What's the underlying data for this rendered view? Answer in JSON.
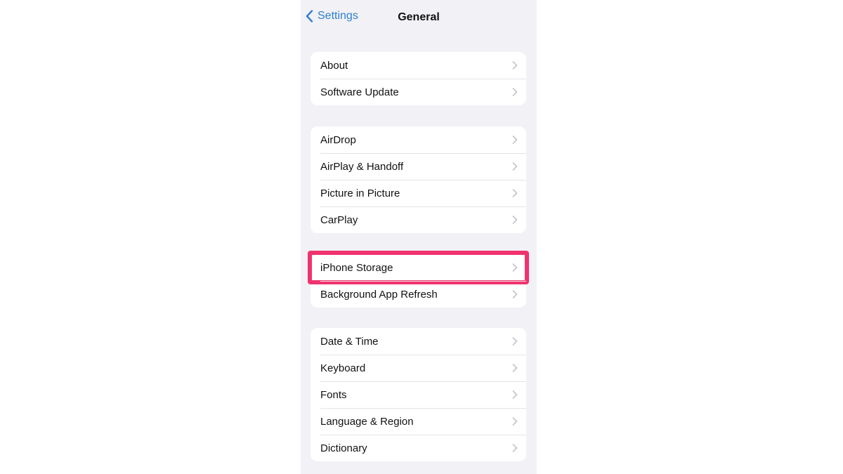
{
  "nav": {
    "back_label": "Settings",
    "title": "General"
  },
  "highlight_color": "#f0336e",
  "groups": [
    {
      "items": [
        {
          "label": "About"
        },
        {
          "label": "Software Update"
        }
      ]
    },
    {
      "items": [
        {
          "label": "AirDrop"
        },
        {
          "label": "AirPlay & Handoff"
        },
        {
          "label": "Picture in Picture"
        },
        {
          "label": "CarPlay"
        }
      ]
    },
    {
      "items": [
        {
          "label": "iPhone Storage",
          "highlighted": true
        },
        {
          "label": "Background App Refresh"
        }
      ]
    },
    {
      "items": [
        {
          "label": "Date & Time"
        },
        {
          "label": "Keyboard"
        },
        {
          "label": "Fonts"
        },
        {
          "label": "Language & Region"
        },
        {
          "label": "Dictionary"
        }
      ]
    }
  ]
}
